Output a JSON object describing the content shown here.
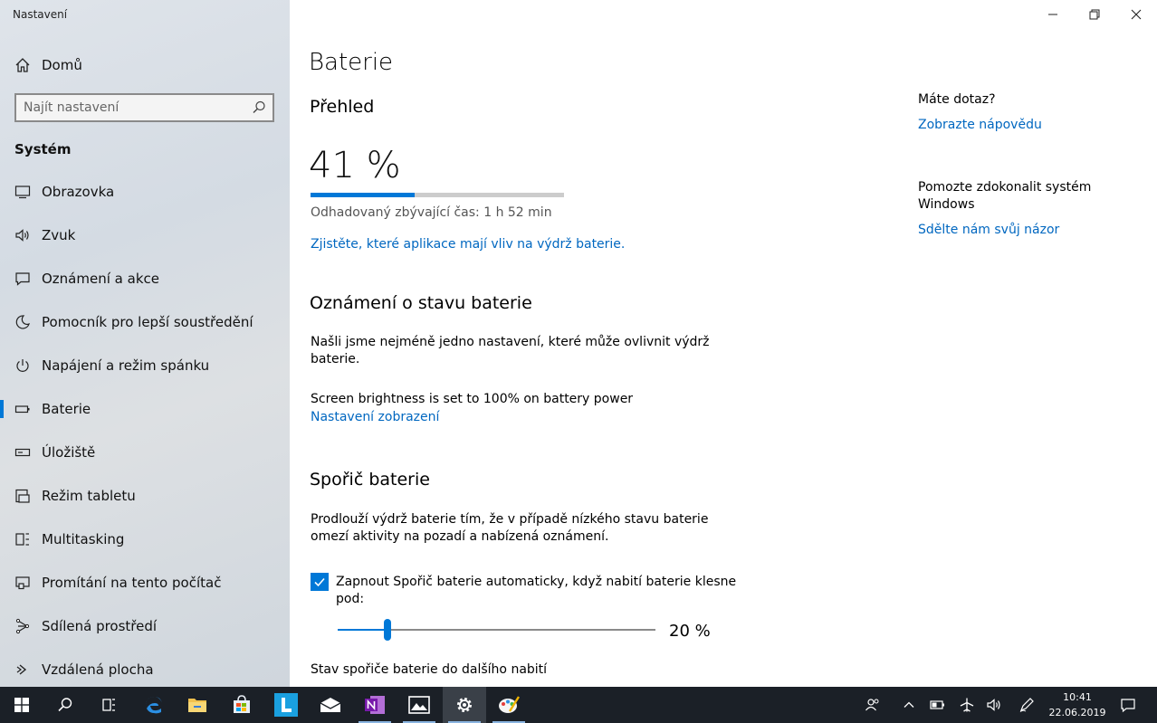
{
  "window": {
    "title": "Nastavení"
  },
  "sidebar": {
    "home_label": "Domů",
    "search_placeholder": "Najít nastavení",
    "section_heading": "Systém",
    "items": [
      {
        "label": "Obrazovka",
        "icon": "monitor-icon"
      },
      {
        "label": "Zvuk",
        "icon": "speaker-icon"
      },
      {
        "label": "Oznámení a akce",
        "icon": "notification-icon"
      },
      {
        "label": "Pomocník pro lepší soustředění",
        "icon": "moon-icon"
      },
      {
        "label": "Napájení a režim spánku",
        "icon": "power-icon"
      },
      {
        "label": "Baterie",
        "icon": "battery-icon",
        "active": true
      },
      {
        "label": "Úložiště",
        "icon": "storage-icon"
      },
      {
        "label": "Režim tabletu",
        "icon": "tablet-icon"
      },
      {
        "label": "Multitasking",
        "icon": "multitasking-icon"
      },
      {
        "label": "Promítání na tento počítač",
        "icon": "projection-icon"
      },
      {
        "label": "Sdílená prostředí",
        "icon": "shared-experiences-icon"
      },
      {
        "label": "Vzdálená plocha",
        "icon": "remote-desktop-icon"
      }
    ]
  },
  "main": {
    "page_title": "Baterie",
    "overview": {
      "heading": "Přehled",
      "percent_text": "41 %",
      "level": 0.41,
      "remaining_time": "Odhadovaný zbývající čas: 1 h 52 min",
      "apps_link": "Zjistěte, které aplikace mají vliv na výdrž baterie."
    },
    "notifications": {
      "heading": "Oznámení o stavu baterie",
      "text_line1": "Našli jsme nejméně jedno nastavení, které může ovlivnit výdrž",
      "text_line2": "baterie.",
      "brightness_text": "Screen brightness is set to 100% on battery power",
      "display_link": "Nastavení zobrazení"
    },
    "saver": {
      "heading": "Spořič baterie",
      "desc_line1": "Prodlouží výdrž baterie tím, že v případě nízkého stavu baterie",
      "desc_line2": "omezí aktivity na pozadí a nabízená oznámení.",
      "checkbox_checked": true,
      "checkbox_label_line1": "Zapnout Spořič baterie automaticky, když nabití baterie klesne",
      "checkbox_label_line2": "pod:",
      "slider_value": 20,
      "slider_value_text": "20 %",
      "status_label": "Stav spořiče baterie do dalšího nabití"
    },
    "aside": {
      "question_heading": "Máte dotaz?",
      "help_link": "Zobrazte nápovědu",
      "improve_line1": "Pomozte zdokonalit systém",
      "improve_line2": "Windows",
      "feedback_link": "Sdělte nám svůj názor"
    }
  },
  "window_controls": [
    "minimize-icon",
    "restore-icon",
    "close-icon"
  ],
  "taskbar": {
    "apps": [
      "windows-start-icon",
      "search-icon",
      "task-view-icon",
      "edge-icon",
      "file-explorer-icon",
      "store-icon",
      "l-app-icon",
      "mail-icon",
      "onenote-icon",
      "photos-icon",
      "settings-icon",
      "paint-icon"
    ],
    "tray": [
      "people-icon",
      "chevron-up-icon",
      "battery-icon",
      "airplane-icon",
      "volume-icon",
      "pen-icon",
      "notification-center-icon"
    ],
    "time": "10:41",
    "date": "22.06.2019"
  },
  "colors": {
    "accent": "#0078d7",
    "link": "#0067c0",
    "taskbar": "#1b2027"
  }
}
